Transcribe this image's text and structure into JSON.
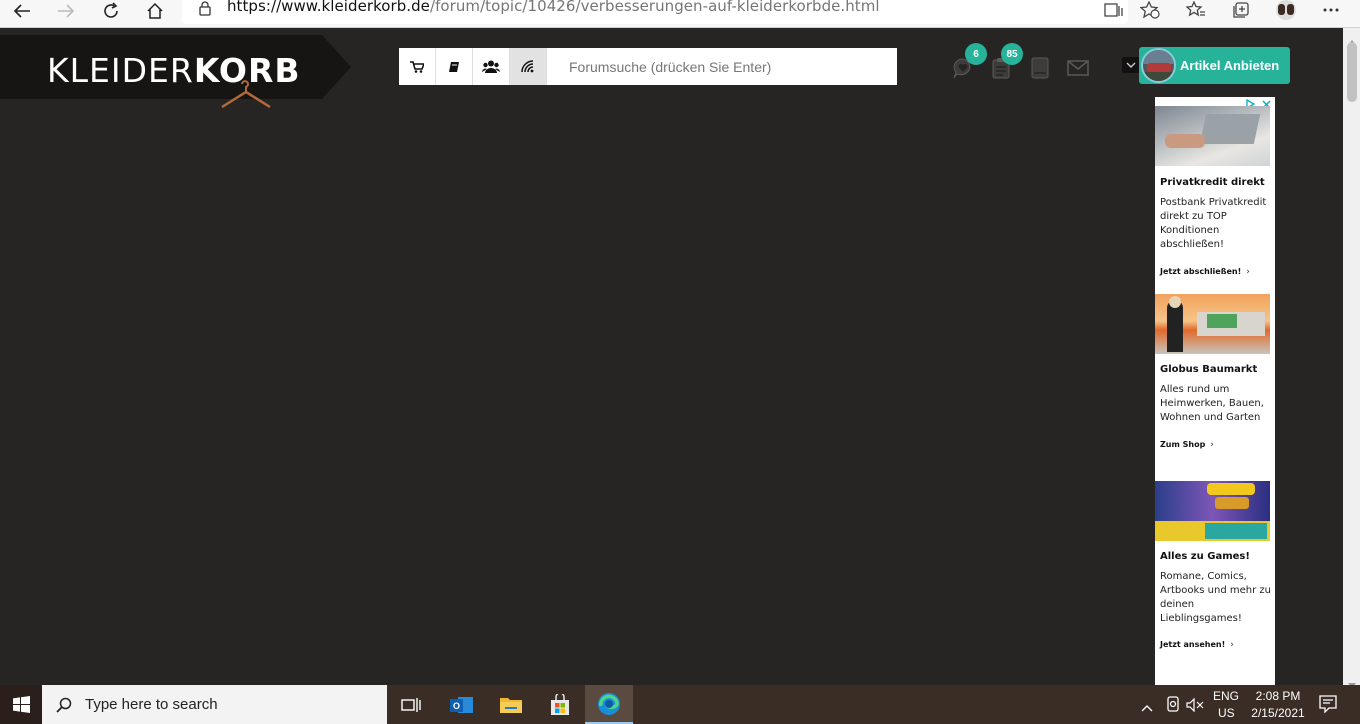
{
  "browser": {
    "url_host": "https://www.kleiderkorb.de",
    "url_path": "/forum/topic/10426/verbesserungen-auf-kleiderkorbde.html"
  },
  "site": {
    "logo_light": "KLEIDER",
    "logo_bold": "KORB",
    "search_placeholder": "Forumsuche (drücken Sie Enter)",
    "chat_badge": "6",
    "notes_badge": "85",
    "sell_button_label": "Artikel Anbieten",
    "accent_color": "#27b39a"
  },
  "ads": [
    {
      "title": "Privatkredit direkt",
      "body": "Postbank Privatkredit direkt zu TOP Konditionen abschließen!",
      "cta": "Jetzt abschließen!"
    },
    {
      "title": "Globus Baumarkt",
      "body": "Alles rund um Heimwerken, Bauen, Wohnen und Garten",
      "cta": "Zum Shop"
    },
    {
      "title": "Alles zu Games!",
      "body": "Romane, Comics, Artbooks und mehr zu deinen Lieblingsgames!",
      "cta": "Jetzt ansehen!"
    }
  ],
  "taskbar": {
    "search_placeholder": "Type here to search",
    "lang_line1": "ENG",
    "lang_line2": "US",
    "time": "2:08 PM",
    "date": "2/15/2021"
  }
}
